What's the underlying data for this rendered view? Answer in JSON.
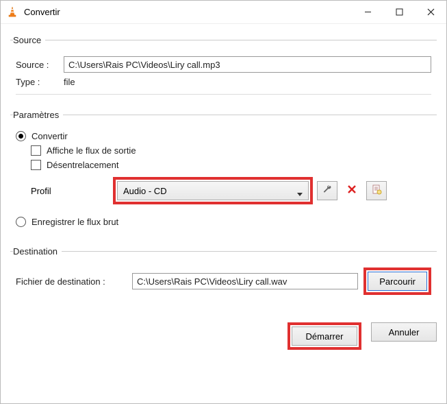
{
  "window": {
    "title": "Convertir"
  },
  "source": {
    "legend": "Source",
    "source_label": "Source :",
    "source_value": "C:\\Users\\Rais PC\\Videos\\Liry call.mp3",
    "type_label": "Type :",
    "type_value": "file"
  },
  "params": {
    "legend": "Paramètres",
    "convert_label": "Convertir",
    "show_output_label": "Affiche le flux de sortie",
    "deinterlace_label": "Désentrelacement",
    "profile_label": "Profil",
    "profile_value": "Audio - CD",
    "save_raw_label": "Enregistrer le flux brut"
  },
  "destination": {
    "legend": "Destination",
    "file_label": "Fichier de destination :",
    "file_value": "C:\\Users\\Rais PC\\Videos\\Liry call.wav",
    "browse_label": "Parcourir"
  },
  "footer": {
    "start_label": "Démarrer",
    "cancel_label": "Annuler"
  }
}
